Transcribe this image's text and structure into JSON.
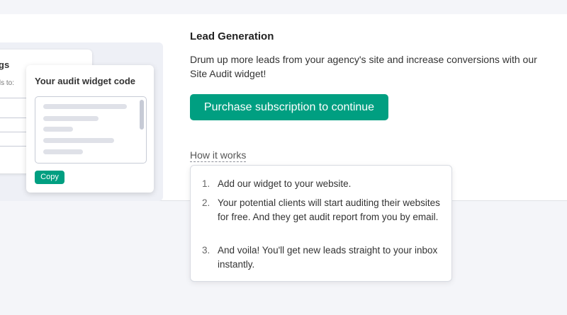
{
  "illustration": {
    "back_title": "gs",
    "back_subtitle": "ads to:",
    "widget_title": "Your audit widget code",
    "copy_label": "Copy"
  },
  "lead": {
    "heading": "Lead Generation",
    "description": "Drum up more leads from your agency's site and increase conversions with our Site Audit widget!",
    "purchase_label": "Purchase subscription to continue",
    "how_label": "How it works"
  },
  "how_it_works": {
    "steps": [
      {
        "num": "1.",
        "text": "Add our widget to your website."
      },
      {
        "num": "2.",
        "text": "Your potential clients will start auditing their websites for free. And they get audit report from you by email."
      },
      {
        "num": "3.",
        "text": "And voila! You'll get new leads straight to your inbox instantly."
      }
    ]
  },
  "colors": {
    "accent": "#009f81",
    "background": "#f4f5f9",
    "card": "#ffffff"
  }
}
